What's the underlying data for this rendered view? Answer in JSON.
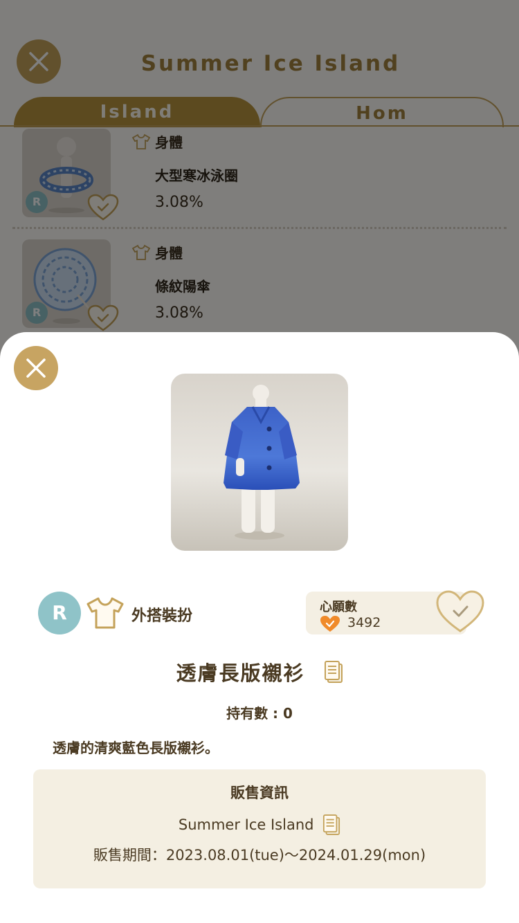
{
  "background": {
    "title": "Summer Ice Island",
    "tabs": [
      {
        "label": "Island"
      },
      {
        "label": "Hom"
      }
    ],
    "items": [
      {
        "category": "身體",
        "name": "大型寒冰泳圈",
        "rate": "3.08%",
        "rarity": "R"
      },
      {
        "category": "身體",
        "name": "條紋陽傘",
        "rate": "3.08%",
        "rarity": "R"
      }
    ]
  },
  "detail": {
    "rarity": "R",
    "category": "外搭裝扮",
    "wishlist_label": "心願數",
    "wishlist_count": "3492",
    "item_name": "透膚長版襯衫",
    "owned": "持有數 : 0",
    "description": "透膚的清爽藍色長版襯衫。",
    "sale": {
      "title": "販售資訊",
      "event": "Summer Ice Island",
      "period": "販售期間：2023.08.01(tue)〜2024.01.29(mon)"
    }
  },
  "colors": {
    "gold": "#c4a25a",
    "rarity_teal": "#8fc3c8",
    "wish_orange": "#f08a2a",
    "text_brown": "#4a3a22"
  },
  "icons": [
    "close-icon",
    "shirt-icon",
    "heart-check-icon",
    "copy-icon"
  ]
}
